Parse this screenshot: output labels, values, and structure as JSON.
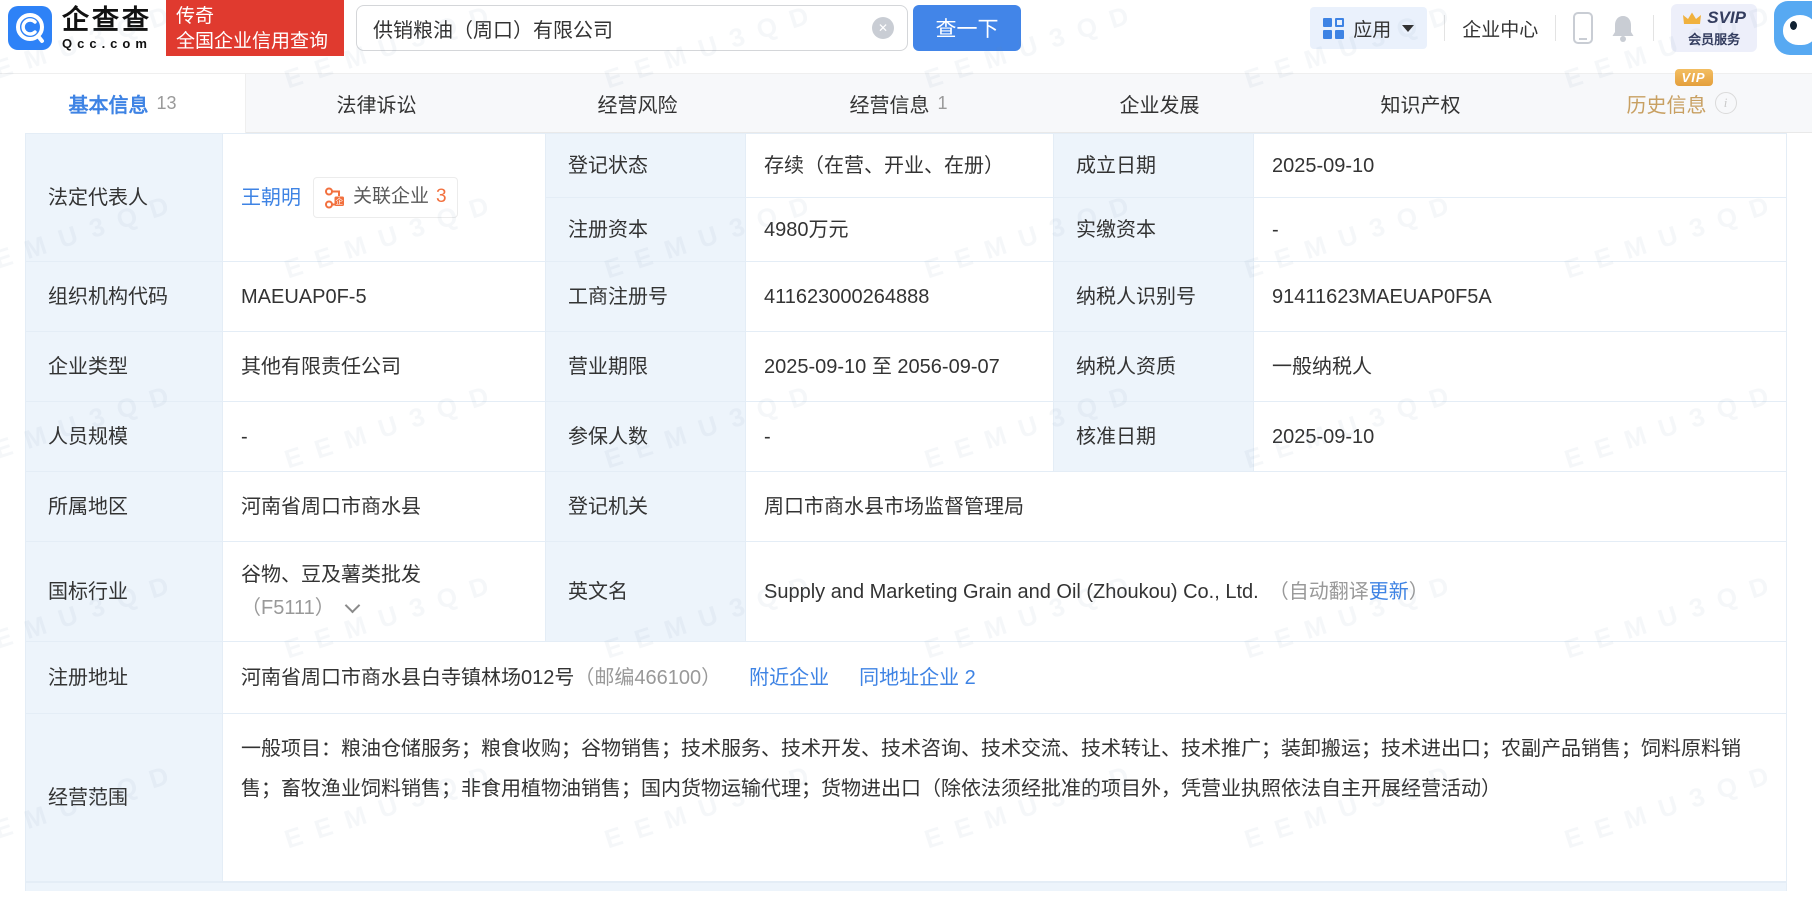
{
  "watermark": {
    "text": "EEMU3QD"
  },
  "header": {
    "brand": {
      "name_cn": "企查查",
      "name_en": "Qcc.com"
    },
    "promo": {
      "line1": "传奇",
      "line2": "全国企业信用查询"
    },
    "search": {
      "value": "供销粮油（周口）有限公司",
      "clear_glyph": "✕",
      "button_label": "查一下"
    },
    "nav": {
      "apps_label": "应用",
      "enterprise_center_label": "企业中心",
      "svip_line1": "SVIP",
      "svip_line2": "会员服务"
    }
  },
  "tabs": [
    {
      "label": "基本信息",
      "count": "13"
    },
    {
      "label": "法律诉讼"
    },
    {
      "label": "经营风险"
    },
    {
      "label": "经营信息",
      "count": "1"
    },
    {
      "label": "企业发展"
    },
    {
      "label": "知识产权"
    },
    {
      "label": "历史信息",
      "vip_badge": "VIP",
      "info_glyph": "i"
    }
  ],
  "fields": {
    "legal_rep": {
      "label": "法定代表人",
      "name": "王朝明",
      "related_label": "关联企业",
      "related_count": "3"
    },
    "reg_status": {
      "label": "登记状态",
      "value": "存续（在营、开业、在册）"
    },
    "est_date": {
      "label": "成立日期",
      "value": "2025-09-10"
    },
    "reg_capital": {
      "label": "注册资本",
      "value": "4980万元"
    },
    "paid_capital": {
      "label": "实缴资本",
      "value": "-"
    },
    "org_code": {
      "label": "组织机构代码",
      "value": "MAEUAP0F-5"
    },
    "biz_reg_no": {
      "label": "工商注册号",
      "value": "411623000264888"
    },
    "taxpayer_id": {
      "label": "纳税人识别号",
      "value": "91411623MAEUAP0F5A"
    },
    "company_type": {
      "label": "企业类型",
      "value": "其他有限责任公司"
    },
    "biz_term": {
      "label": "营业期限",
      "value": "2025-09-10 至 2056-09-07"
    },
    "taxpayer_qual": {
      "label": "纳税人资质",
      "value": "一般纳税人"
    },
    "staff_size": {
      "label": "人员规模",
      "value": "-"
    },
    "insured_count": {
      "label": "参保人数",
      "value": "-"
    },
    "approval_date": {
      "label": "核准日期",
      "value": "2025-09-10"
    },
    "region": {
      "label": "所属地区",
      "value": "河南省周口市商水县"
    },
    "reg_authority": {
      "label": "登记机关",
      "value": "周口市商水县市场监督管理局"
    },
    "industry": {
      "label": "国标行业",
      "value": "谷物、豆及薯类批发",
      "code": "（F5111）"
    },
    "english_name": {
      "label": "英文名",
      "value": "Supply and Marketing Grain and Oil (Zhoukou) Co., Ltd.",
      "note_prefix": "（自动翻译",
      "update_link": "更新",
      "note_suffix": "）"
    },
    "address": {
      "label": "注册地址",
      "value": "河南省周口市商水县白寺镇林场012号",
      "postal": "（邮编466100）",
      "nearby_link": "附近企业",
      "same_addr_link": "同地址企业 2"
    },
    "business_scope": {
      "label": "经营范围",
      "value": "一般项目：粮油仓储服务；粮食收购；谷物销售；技术服务、技术开发、技术咨询、技术交流、技术转让、技术推广；装卸搬运；技术进出口；农副产品销售；饲料原料销售；畜牧渔业饲料销售；非食用植物油销售；国内货物运输代理；货物进出口（除依法须经批准的项目外，凭营业执照依法自主开展经营活动）"
    }
  }
}
